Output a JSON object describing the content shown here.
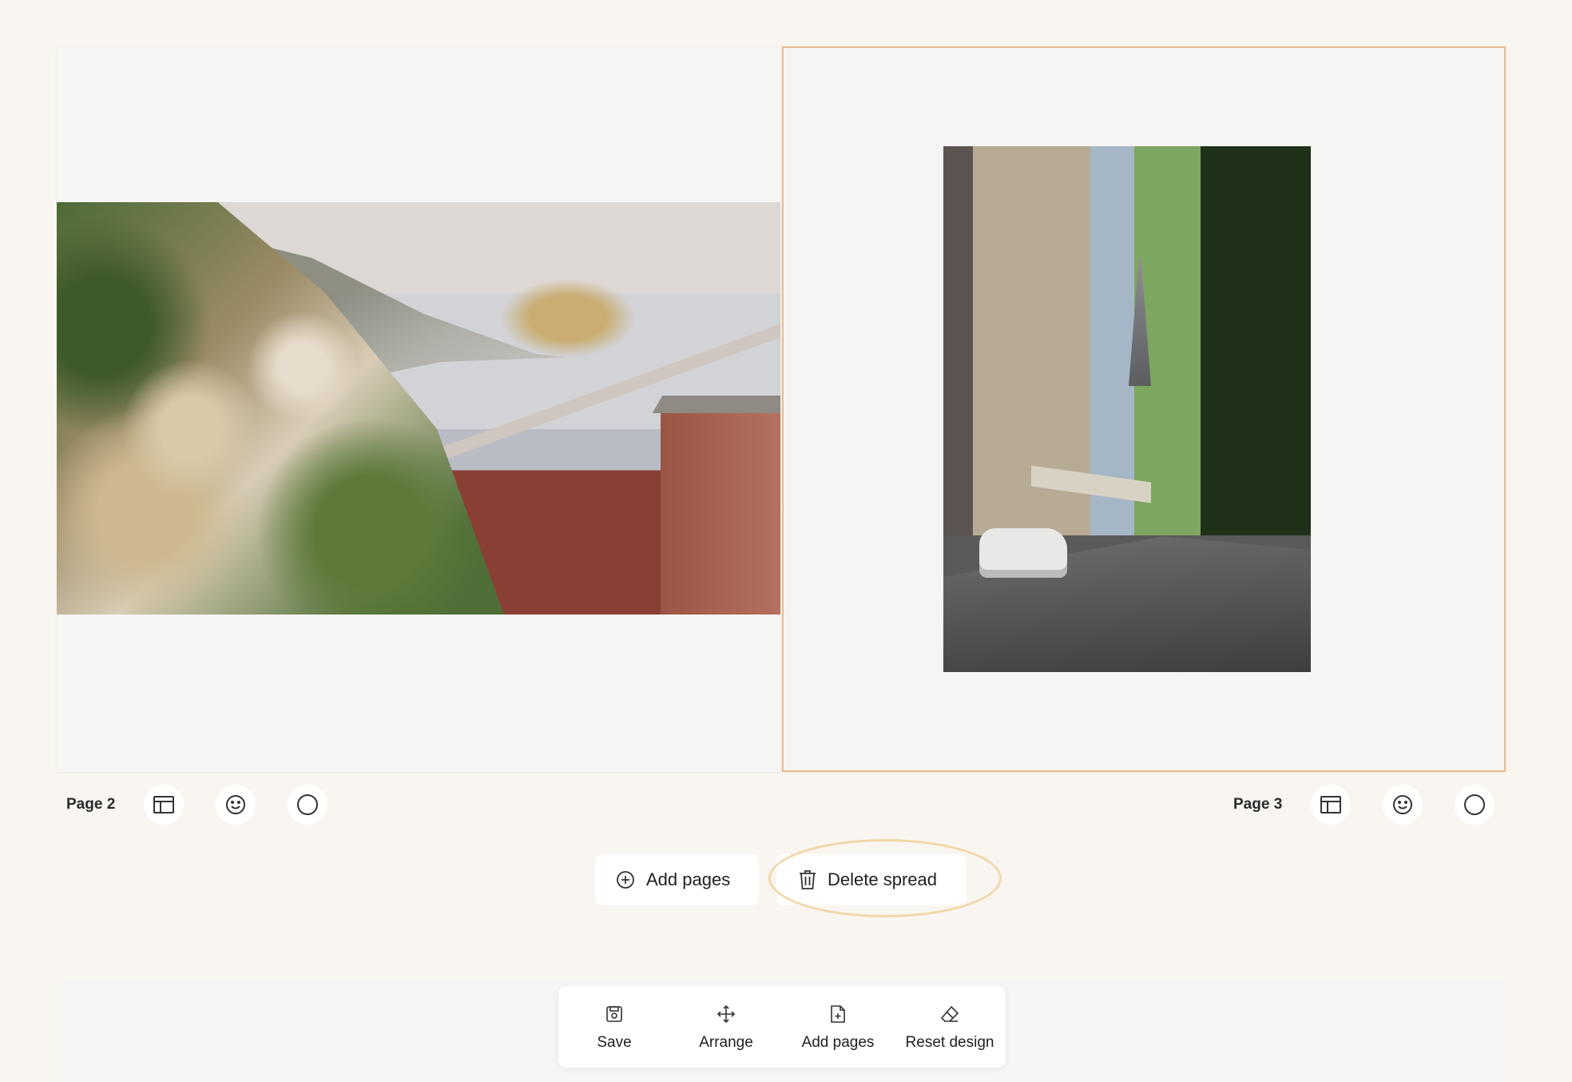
{
  "spread": {
    "left_page": {
      "label": "Page 2",
      "photo": "coastal-hillside-village-photo"
    },
    "right_page": {
      "label": "Page 3",
      "photo": "paris-street-eiffel-tower-photo",
      "selected": true
    }
  },
  "page_controls": {
    "icons": [
      "layout-icon",
      "smiley-icon",
      "circle-icon"
    ]
  },
  "actions": {
    "add_pages": "Add pages",
    "delete_spread": "Delete spread"
  },
  "toolbar": {
    "save": "Save",
    "arrange": "Arrange",
    "add_pages": "Add pages",
    "reset_design": "Reset design"
  },
  "colors": {
    "background": "#f9f6f1",
    "page": "#f6f5f3",
    "selected_border": "#e9b98f",
    "highlight_ring": "#f1d7a9"
  }
}
